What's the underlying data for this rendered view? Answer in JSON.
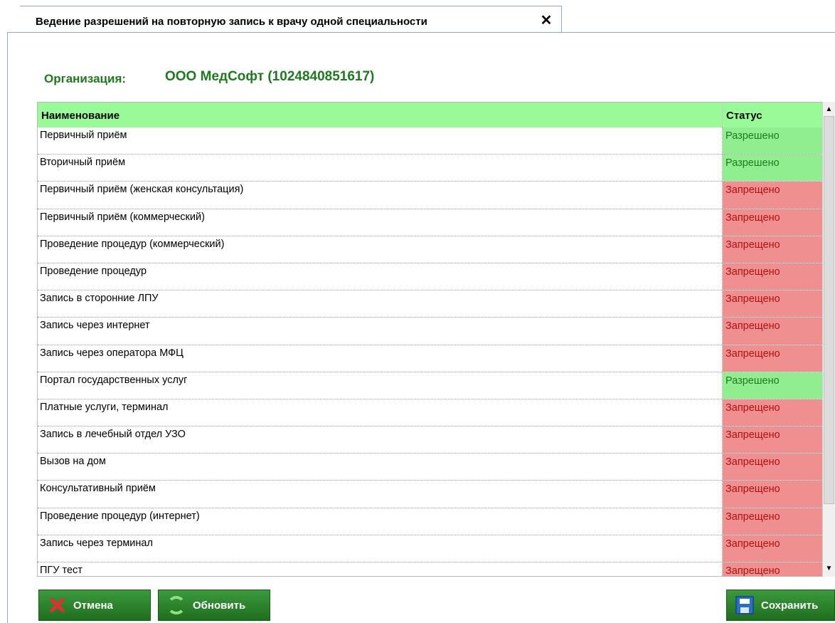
{
  "tab": {
    "title": "Ведение разрешений на повторную запись к врачу одной специальности",
    "close_label": "✕"
  },
  "organization": {
    "label": "Организация:",
    "value": "ООО МедСофт (1024840851617)"
  },
  "grid": {
    "columns": {
      "name": "Наименование",
      "status": "Статус"
    },
    "rows": [
      {
        "name": "Первичный приём",
        "status": "Разрешено"
      },
      {
        "name": "Вторичный приём",
        "status": "Разрешено"
      },
      {
        "name": "Первичный приём (женская консультация)",
        "status": "Запрещено"
      },
      {
        "name": "Первичный приём (коммерческий)",
        "status": "Запрещено"
      },
      {
        "name": "Проведение процедур (коммерческий)",
        "status": "Запрещено"
      },
      {
        "name": "Проведение процедур",
        "status": "Запрещено"
      },
      {
        "name": "Запись в сторонние ЛПУ",
        "status": "Запрещено"
      },
      {
        "name": "Запись через интернет",
        "status": "Запрещено"
      },
      {
        "name": "Запись через оператора МФЦ",
        "status": "Запрещено"
      },
      {
        "name": "Портал государственных услуг",
        "status": "Разрешено"
      },
      {
        "name": "Платные услуги, терминал",
        "status": "Запрещено"
      },
      {
        "name": "Запись в лечебный отдел УЗО",
        "status": "Запрещено"
      },
      {
        "name": "Вызов на дом",
        "status": "Запрещено"
      },
      {
        "name": "Консультативный приём",
        "status": "Запрещено"
      },
      {
        "name": "Проведение процедур (интернет)",
        "status": "Запрещено"
      },
      {
        "name": "Запись через терминал",
        "status": "Запрещено"
      },
      {
        "name": "ПГУ тест",
        "status": "Запрещено"
      }
    ]
  },
  "buttons": {
    "cancel": "Отмена",
    "refresh": "Обновить",
    "save": "Сохранить"
  },
  "colors": {
    "header_bg": "#98fb98",
    "allowed_bg": "#90ee90",
    "denied_bg": "#f08f8f",
    "accent_green": "#1e7a1e"
  },
  "icons": {
    "close": "close-icon",
    "cancel": "x-icon",
    "refresh": "refresh-icon",
    "save": "floppy-disk-icon",
    "scroll_up": "scroll-up-arrow-icon",
    "scroll_down": "scroll-down-arrow-icon"
  }
}
